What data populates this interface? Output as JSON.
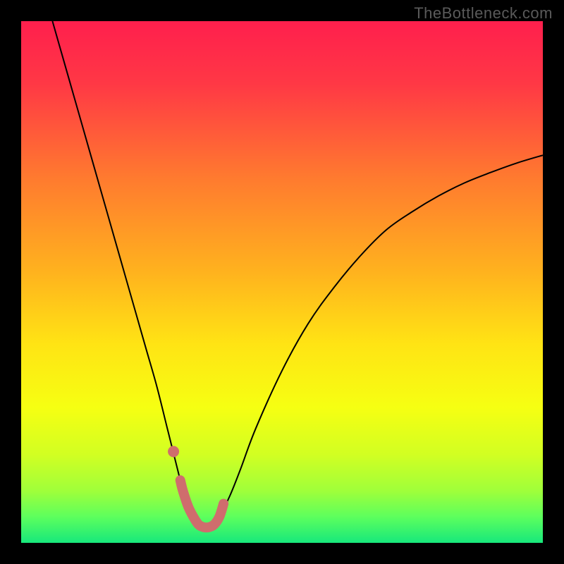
{
  "watermark": "TheBottleneck.com",
  "chart_data": {
    "type": "line",
    "title": "",
    "xlabel": "",
    "ylabel": "",
    "xlim": [
      0,
      100
    ],
    "ylim": [
      0,
      100
    ],
    "grid": false,
    "background_gradient": {
      "stops": [
        {
          "offset": 0.0,
          "color": "#ff1f4d"
        },
        {
          "offset": 0.12,
          "color": "#ff3845"
        },
        {
          "offset": 0.3,
          "color": "#ff7a2f"
        },
        {
          "offset": 0.48,
          "color": "#ffb21e"
        },
        {
          "offset": 0.62,
          "color": "#ffe414"
        },
        {
          "offset": 0.74,
          "color": "#f6ff12"
        },
        {
          "offset": 0.83,
          "color": "#d2ff22"
        },
        {
          "offset": 0.9,
          "color": "#a0ff3a"
        },
        {
          "offset": 0.95,
          "color": "#5dff5d"
        },
        {
          "offset": 1.0,
          "color": "#17e87c"
        }
      ]
    },
    "series": [
      {
        "name": "bottleneck-curve",
        "color": "#000000",
        "width": 2,
        "x": [
          6,
          8,
          10,
          12,
          14,
          16,
          18,
          20,
          22,
          24,
          26,
          28,
          30,
          31,
          32,
          33,
          34,
          35,
          36,
          37,
          38,
          40,
          42,
          45,
          50,
          55,
          60,
          65,
          70,
          75,
          80,
          85,
          90,
          95,
          100
        ],
        "y": [
          100,
          93,
          86,
          79,
          72,
          65,
          58,
          51,
          44,
          37,
          30,
          22,
          14,
          10,
          7,
          5,
          3.5,
          3,
          3,
          3.5,
          5,
          9,
          14,
          22,
          33,
          42,
          49,
          55,
          60,
          63.5,
          66.5,
          69,
          71,
          72.8,
          74.3
        ]
      },
      {
        "name": "highlight-band",
        "color": "#cf6d6d",
        "width": 14,
        "cap": "round",
        "x": [
          30.5,
          31,
          32,
          33,
          34,
          35,
          36,
          37,
          38,
          38.8
        ],
        "y": [
          12,
          10,
          7,
          5,
          3.5,
          3,
          3,
          3.5,
          5,
          7.5
        ]
      },
      {
        "name": "highlight-dot",
        "type": "scatter",
        "color": "#cf6d6d",
        "radius": 8,
        "x": [
          29.2
        ],
        "y": [
          17.5
        ]
      }
    ]
  }
}
